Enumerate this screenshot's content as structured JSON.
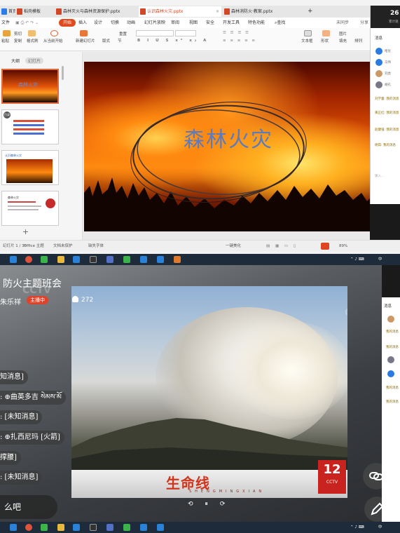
{
  "wps": {
    "tabs": [
      {
        "label": "首页",
        "color": "#2b7de9"
      },
      {
        "label": "稻壳模板",
        "color": "#d24726"
      },
      {
        "label": "森林灭火与森林资源保护.pptx",
        "color": "#d24726"
      },
      {
        "label": "认识森林火灾.pptx",
        "color": "#d24726"
      },
      {
        "label": "森林消防火·教案.pptx",
        "color": "#d24726"
      }
    ],
    "menu": [
      "文件",
      "开始",
      "插入",
      "设计",
      "切换",
      "动画",
      "幻灯片放映",
      "审阅",
      "视图",
      "安全",
      "开发工具",
      "特色功能",
      "查找"
    ],
    "menu_right": [
      "未同步",
      "分享"
    ],
    "ribbon": {
      "paste": "粘贴",
      "cut": "剪切",
      "copy": "复制",
      "format_painter": "格式刷",
      "from_current": "从当前开始",
      "new_slide": "新建幻灯片",
      "layout": "版式",
      "section": "节",
      "reset": "重置",
      "textbox": "文本框",
      "shape": "形状",
      "picture": "图片",
      "fill": "填充",
      "arrange": "排列"
    },
    "panel_tabs": [
      "大纲",
      "幻灯片"
    ],
    "slide_title": "森林火灾",
    "thumb_titles": [
      "森林火灾",
      "目录",
      "认识森林火灾",
      "森林火灾"
    ],
    "add_slide": "+",
    "status": {
      "slide_info": "幻灯片 1 / 35",
      "theme": "Office 主题",
      "protect": "文档未保护",
      "font_missing": "缺失字体",
      "beautify": "一键美化",
      "zoom": "89%"
    },
    "chat": {
      "header_title": "26",
      "header_sub": "累计观",
      "label": "消息",
      "users": [
        "哈尼",
        "马伟",
        "刘虎",
        "胡孔"
      ],
      "messages": [
        "刘学童: 我的消息",
        "黄正红: 我的消息",
        "赵健强: 我的消息",
        "杨茹: 我的消息"
      ],
      "footer": "输入…"
    }
  },
  "live": {
    "title": "防火主题班会",
    "host_name": "朱乐祥",
    "host_badge": "主播中",
    "viewers": "272",
    "messages": [
      "知消息]",
      ": ⊕曲英多吉 སེམས་མོ",
      ": [未知消息]",
      ": ⊕扎西尼玛 [火箭]",
      "撑腰]",
      ": [未知消息]"
    ],
    "input_text": "么吧",
    "show_name": "生命线",
    "show_sub": "SHENGMINGXIAN",
    "channel_num": "12",
    "channel_brand": "CCTV",
    "watermark": "CCTV",
    "controls": [
      "⟲",
      "⏸",
      "⟳"
    ],
    "right_chat_label": "消息",
    "right_chat_lines": [
      "我的消息",
      "我的消息",
      "我的消息",
      "我的消息"
    ]
  },
  "taskbar": {
    "tray": "中",
    "clock": ""
  }
}
